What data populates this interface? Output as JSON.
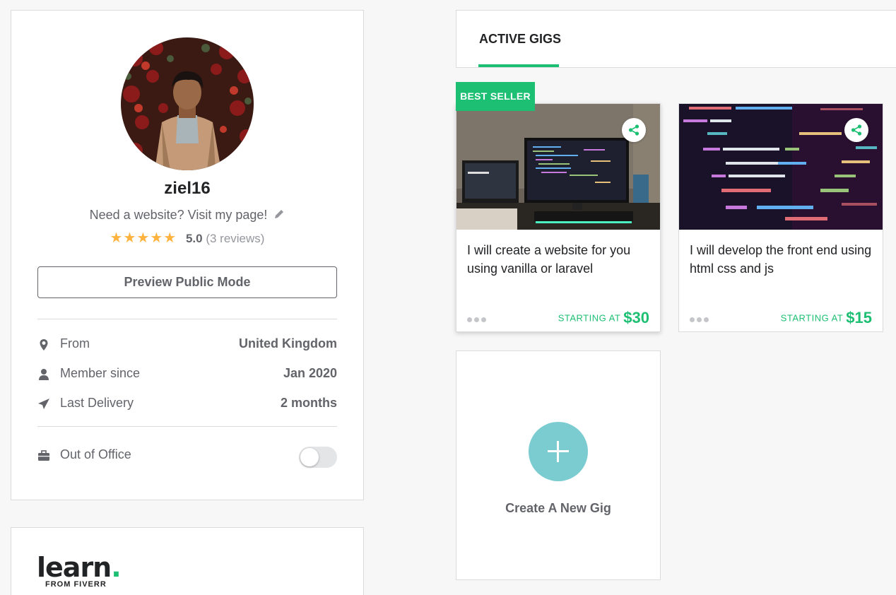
{
  "profile": {
    "username": "ziel16",
    "tagline": "Need a website? Visit my page!",
    "rating": {
      "stars": 5,
      "score": "5.0",
      "reviews": "(3 reviews)"
    },
    "preview_button": "Preview Public Mode",
    "info": [
      {
        "icon": "location-pin-icon",
        "label": "From",
        "value": "United Kingdom"
      },
      {
        "icon": "user-icon",
        "label": "Member since",
        "value": "Jan 2020"
      },
      {
        "icon": "paper-plane-icon",
        "label": "Last Delivery",
        "value": "2 months"
      }
    ],
    "out_of_office": {
      "label": "Out of Office",
      "enabled": false
    }
  },
  "learn": {
    "word": "learn",
    "dot": ".",
    "sub": "FROM FIVERR"
  },
  "gigs_tabs": {
    "active": "ACTIVE GIGS"
  },
  "gigs": [
    {
      "badge": "BEST SELLER",
      "title": "I will create a website for you using vanilla or laravel",
      "price_label": "STARTING AT",
      "price": "$30"
    },
    {
      "title": "I will develop the front end using html css and js",
      "price_label": "STARTING AT",
      "price": "$15"
    }
  ],
  "new_gig": {
    "label": "Create A New Gig"
  },
  "colors": {
    "accent": "#1dbf73",
    "star": "#ffb33e",
    "create_circle": "#7accd1"
  }
}
